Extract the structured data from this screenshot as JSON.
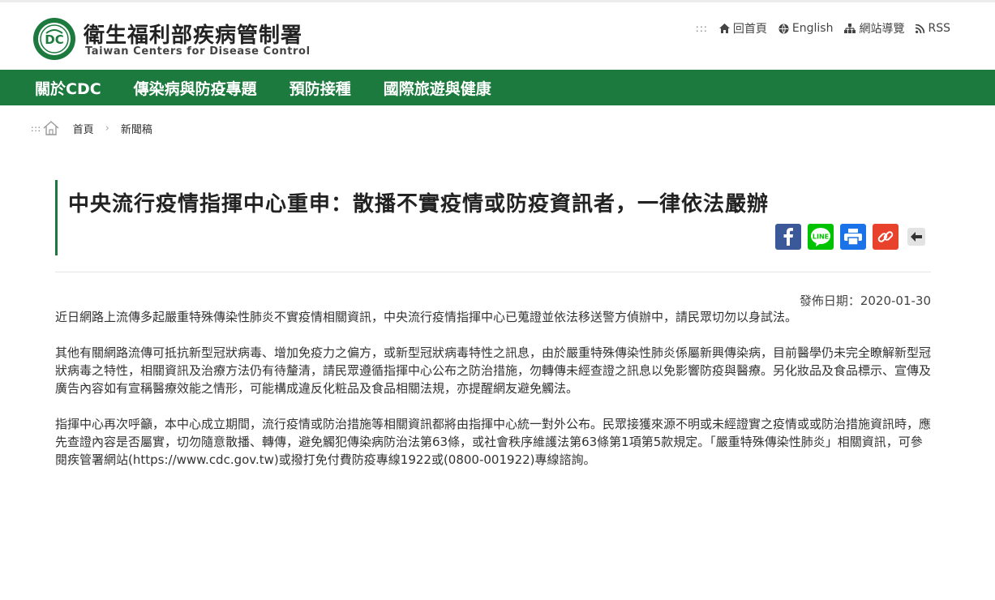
{
  "header": {
    "org_name_cn": "衛生福利部疾病管制署",
    "org_name_en": "Taiwan Centers for Disease Control",
    "util_access_key": ":::",
    "util_links": [
      "回首頁",
      "English",
      "網站導覽",
      "RSS"
    ]
  },
  "nav": {
    "items": [
      "關於CDC",
      "傳染病與防疫專題",
      "預防接種",
      "國際旅遊與健康"
    ]
  },
  "breadcrumb": {
    "access_key": ":::",
    "items": [
      "首頁",
      "新聞稿"
    ]
  },
  "article": {
    "title": "中央流行疫情指揮中心重申：散播不實疫情或防疫資訊者，一律依法嚴辦",
    "publish_date": "發佈日期：2020-01-30",
    "paragraphs": [
      "近日網路上流傳多起嚴重特殊傳染性肺炎不實疫情相關資訊，中央流行疫情指揮中心已蒐證並依法移送警方偵辦中，請民眾切勿以身試法。",
      "其他有關網路流傳可抵抗新型冠狀病毒、增加免疫力之偏方，或新型冠狀病毒特性之訊息，由於嚴重特殊傳染性肺炎係屬新興傳染病，目前醫學仍未完全瞭解新型冠狀病毒之特性，相關資訊及治療方法仍有待釐清，請民眾遵循指揮中心公布之防治措施，勿轉傳未經查證之訊息以免影響防疫與醫療。另化妝品及食品標示、宣傳及廣告內容如有宣稱醫療效能之情形，可能構成違反化粧品及食品相關法規，亦提醒網友避免觸法。",
      "指揮中心再次呼籲，本中心成立期間，流行疫情或防治措施等相關資訊都將由指揮中心統一對外公布。民眾接獲來源不明或未經證實之疫情或或防治措施資訊時，應先查證內容是否屬實，切勿隨意散播、轉傳，避免觸犯傳染病防治法第63條，或社會秩序維護法第63條第1項第5款規定。「嚴重特殊傳染性肺炎」相關資訊，可參閱疾管署網站(https://www.cdc.gov.tw)或撥打免付費防疫專線1922或(0800-001922)專線諮詢。"
    ]
  },
  "share": {
    "line_label": "LINE",
    "colors": {
      "facebook": "#3b5998",
      "line": "#00c300",
      "print": "#1a73e8",
      "link": "#e8412c"
    }
  },
  "colors": {
    "brand_green": "#1c7a3e"
  },
  "icons": {
    "home": "home-icon",
    "english": "globe-icon",
    "sitemap": "sitemap-icon",
    "rss": "rss-icon"
  }
}
